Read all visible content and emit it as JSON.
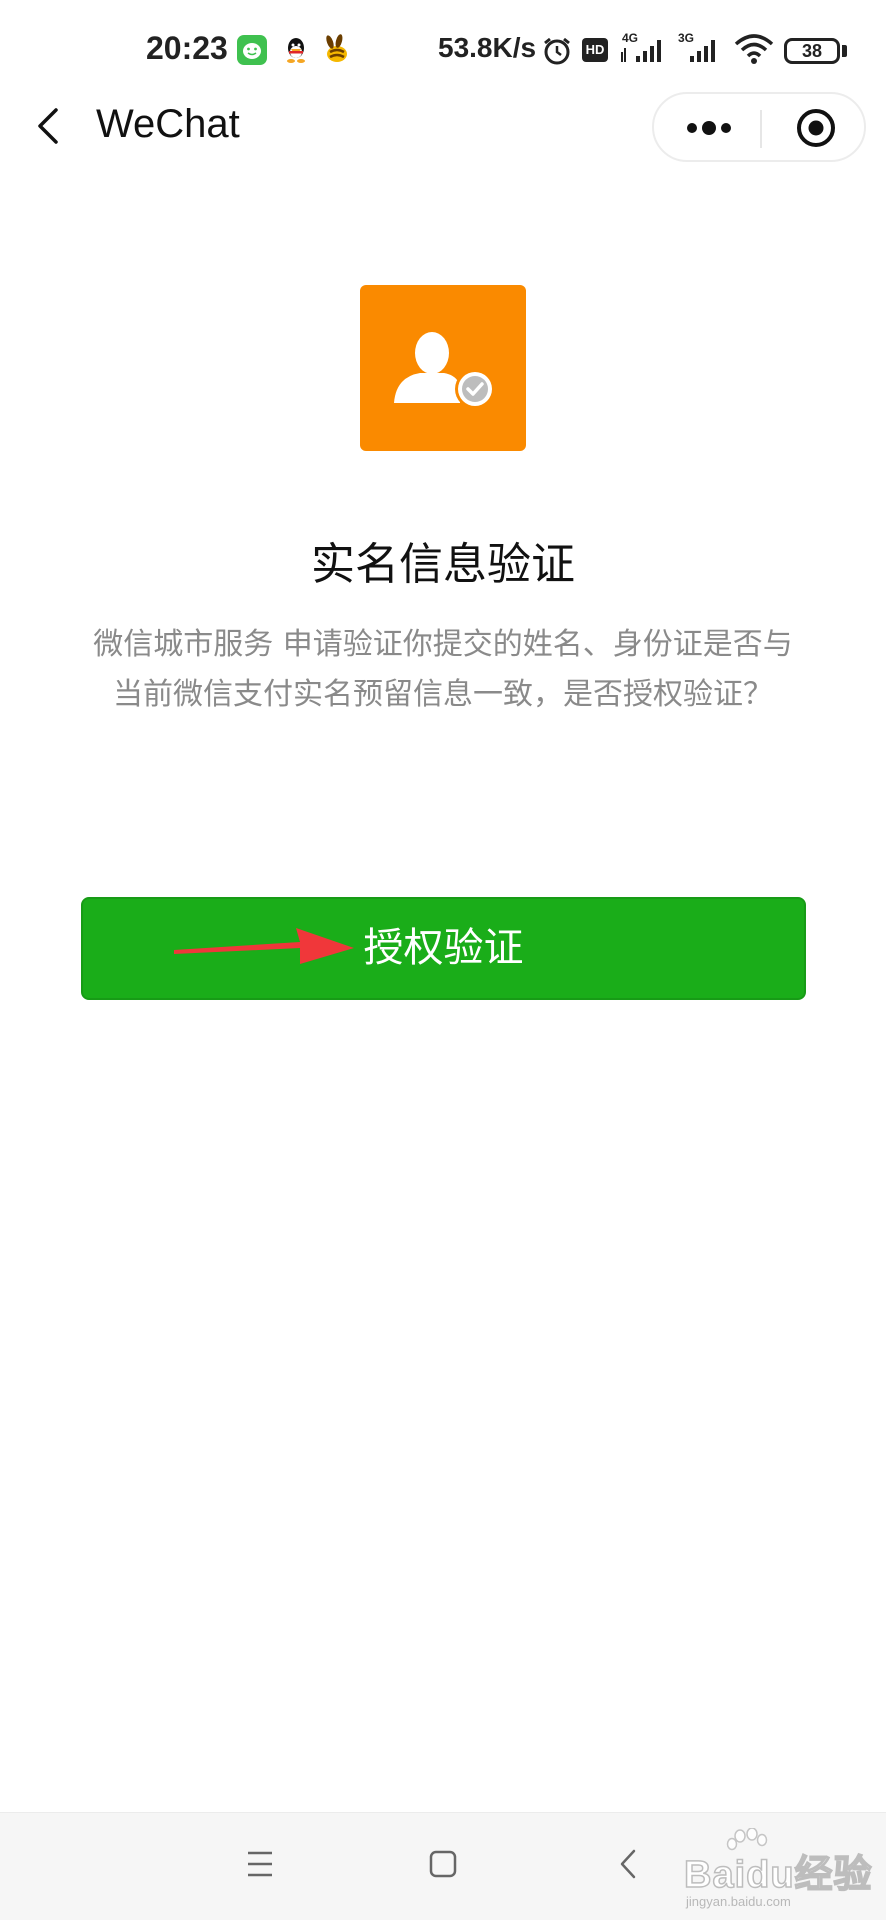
{
  "status_bar": {
    "time": "20:23",
    "network_speed": "53.8K/s",
    "battery_level": "38",
    "icons": [
      "wechat-app-icon",
      "qq-icon",
      "bee-app-icon",
      "alarm-icon",
      "hd-icon",
      "signal-4g-icon",
      "signal-3g-icon",
      "wifi-icon"
    ],
    "hd_label": "HD",
    "net_4g_label": "4G",
    "net_3g_label": "3G"
  },
  "nav": {
    "title": "WeChat",
    "back_icon": "chevron-left-icon",
    "more_icon": "more-dots-icon",
    "close_icon": "target-circle-icon"
  },
  "content": {
    "logo_icon": "verified-user-icon",
    "logo_color": "#fa8a00",
    "title": "实名信息验证",
    "description": "微信城市服务 申请验证你提交的姓名、身份证是否与当前微信支付实名预留信息一致，是否授权验证？",
    "button_label": "授权验证",
    "button_color": "#1aad19",
    "annotation_arrow_color": "#f0373a"
  },
  "bottom_nav": {
    "menu_icon": "menu-lines-icon",
    "home_icon": "home-square-icon",
    "back_icon": "back-triangle-icon"
  },
  "watermark": {
    "text": "Baidu经验",
    "subtext": "jingyan.baidu.com"
  }
}
